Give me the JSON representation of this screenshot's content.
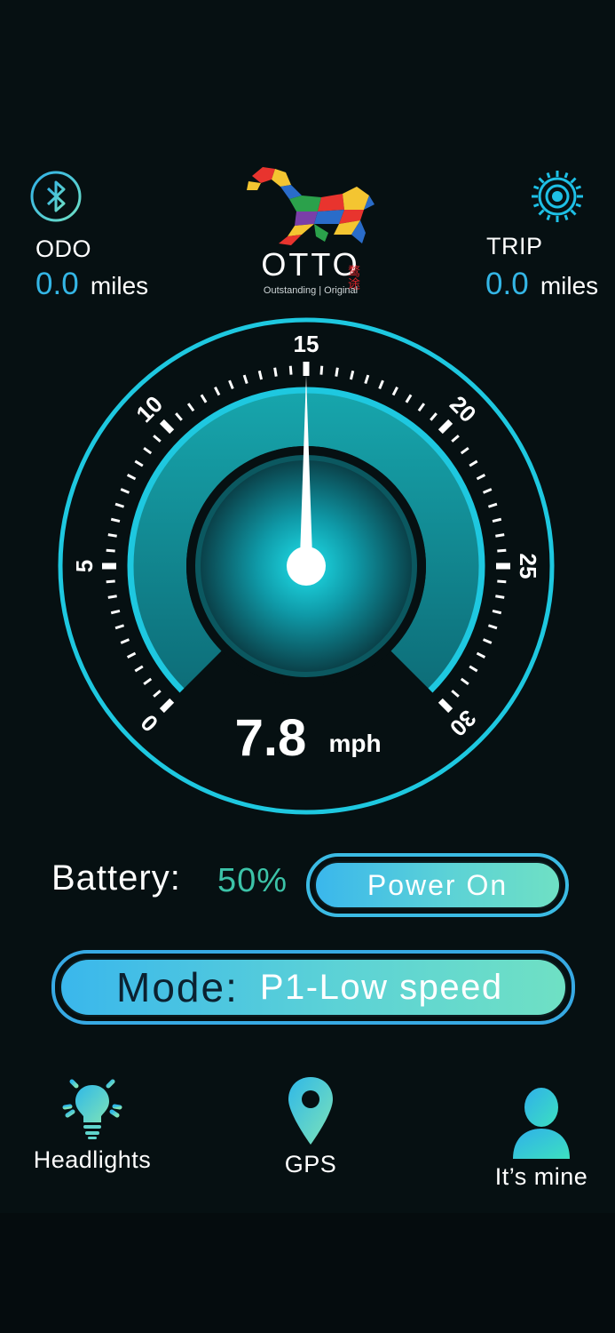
{
  "brand": {
    "logo_text": "OTTO",
    "tagline": "Outstanding | Original",
    "chinese_mark": "鹜途"
  },
  "odo": {
    "label": "ODO",
    "value": "0.0",
    "unit": "miles"
  },
  "trip": {
    "label": "TRIP",
    "value": "0.0",
    "unit": "miles"
  },
  "gauge": {
    "ticks": [
      "0",
      "5",
      "10",
      "15",
      "20",
      "25",
      "30"
    ],
    "min": 0,
    "max": 30,
    "speed_value": 7.8,
    "speed": "7.8",
    "speed_unit": "mph",
    "needle_value": 15
  },
  "battery": {
    "label": "Battery:",
    "value": "50%"
  },
  "power_button": {
    "label": "Power On"
  },
  "mode": {
    "label": "Mode:",
    "value": "P1-Low speed"
  },
  "nav": {
    "headlights": {
      "label": "Headlights",
      "icon": "bulb-icon"
    },
    "gps": {
      "label": "GPS",
      "icon": "map-pin-icon"
    },
    "mine": {
      "label": "It’s mine",
      "icon": "user-icon"
    }
  },
  "colors": {
    "accent": "#1ec8e0",
    "text_blue": "#34b6e6",
    "battery_green": "#3cc3a8",
    "background": "#061012"
  }
}
